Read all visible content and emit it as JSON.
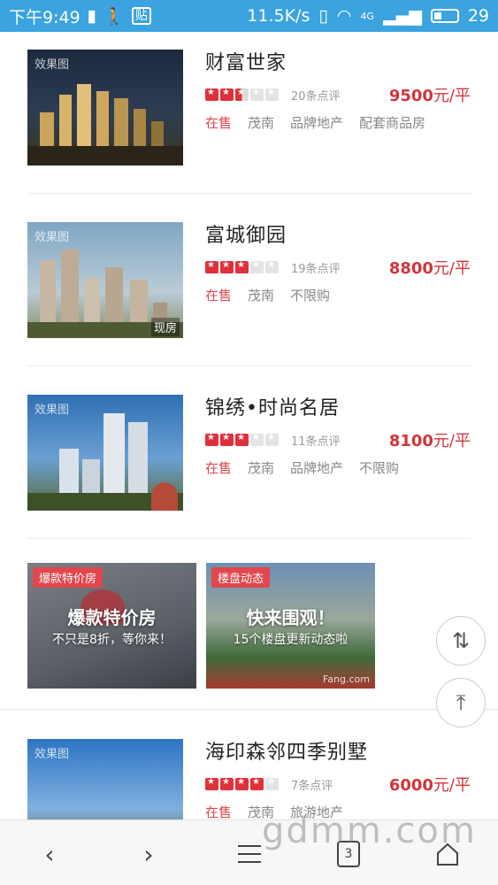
{
  "status_bar": {
    "time": "下午9:49",
    "net_speed": "11.5K/s",
    "network": "4G",
    "battery": "29"
  },
  "listings": [
    {
      "name": "财富世家",
      "watermark": "效果图",
      "rating": 2.5,
      "reviews": "20条点评",
      "price": "9500",
      "price_unit": "元/平",
      "tags": [
        "在售",
        "茂南",
        "品牌地产",
        "配套商品房"
      ]
    },
    {
      "name": "富城御园",
      "watermark": "效果图",
      "badge": "现房",
      "rating": 3,
      "reviews": "19条点评",
      "price": "8800",
      "price_unit": "元/平",
      "tags": [
        "在售",
        "茂南",
        "不限购"
      ]
    },
    {
      "name": "锦绣•时尚名居",
      "watermark": "效果图",
      "rating": 3,
      "reviews": "11条点评",
      "price": "8100",
      "price_unit": "元/平",
      "tags": [
        "在售",
        "茂南",
        "品牌地产",
        "不限购"
      ]
    },
    {
      "name": "海印森邻四季别墅",
      "watermark": "效果图",
      "rating": 4,
      "reviews": "7条点评",
      "price": "6000",
      "price_unit": "元/平",
      "tags": [
        "在售",
        "茂南",
        "旅游地产"
      ]
    }
  ],
  "promos": [
    {
      "badge": "爆款特价房",
      "title": "爆款特价房",
      "subtitle": "不只是8折，等你来！"
    },
    {
      "badge": "楼盘动态",
      "title": "快来围观！",
      "subtitle": "15个楼盘更新动态啦",
      "credit": "Fang.com"
    }
  ],
  "float_buttons": {
    "sort": "⇅",
    "to_top": "⤒"
  },
  "bottom_nav": {
    "back": "‹",
    "forward": "›",
    "tabs_count": "3"
  },
  "site_watermark": "gdmm.com"
}
